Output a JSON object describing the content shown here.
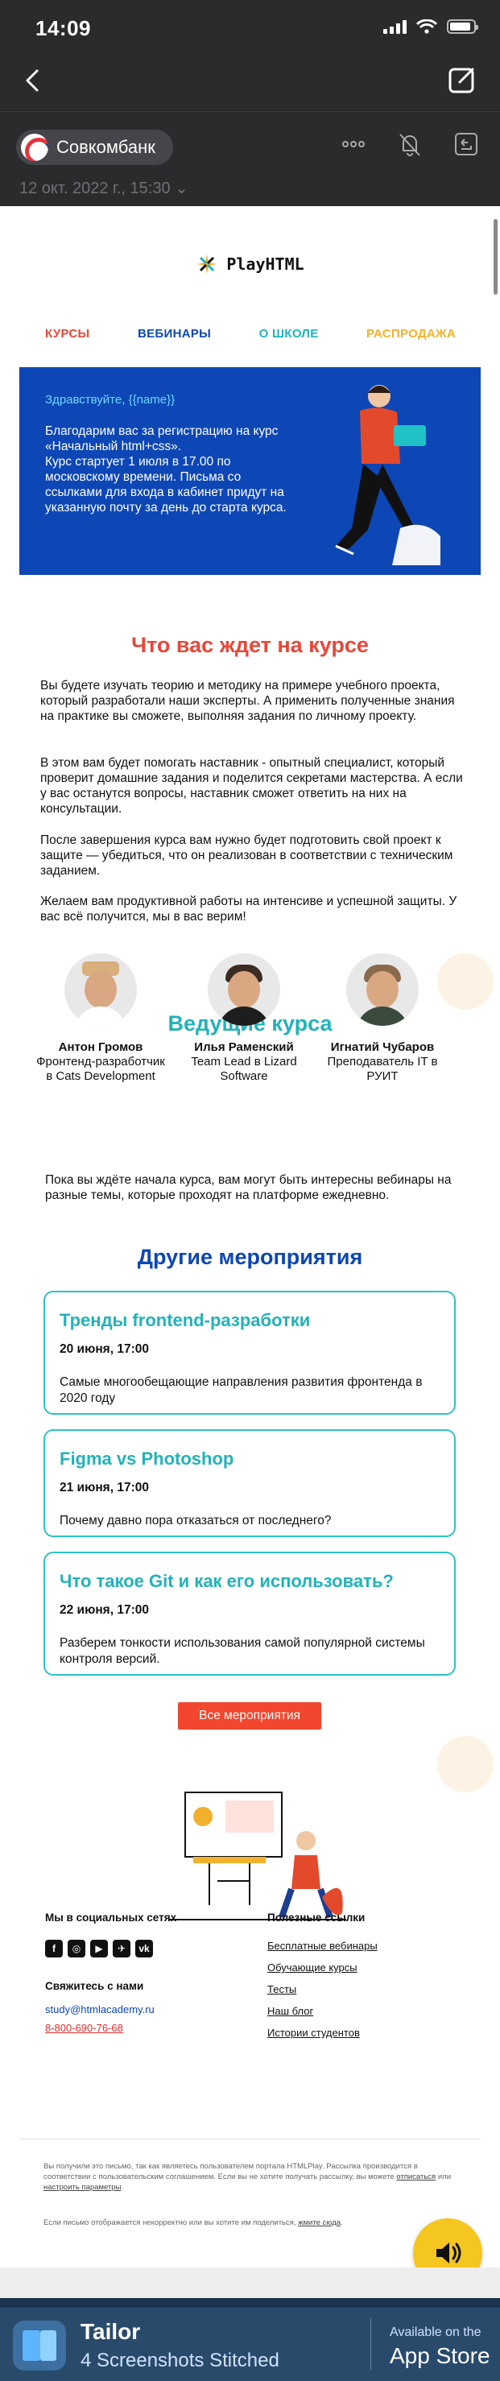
{
  "status": {
    "time": "14:09",
    "battery_level": 0.9
  },
  "mail": {
    "sender": "Совкомбанк",
    "date": "12 окт. 2022 г., 15:30"
  },
  "email": {
    "brand": "PlayHTML",
    "menu": [
      {
        "label": "КУРСЫ",
        "color": "#e8473a"
      },
      {
        "label": "ВЕБИНАРЫ",
        "color": "#0d47b5"
      },
      {
        "label": "О ШКОЛЕ",
        "color": "#21b3b8"
      },
      {
        "label": "РАСПРОДАЖА",
        "color": "#f2b12c"
      }
    ],
    "hero": {
      "greeting": "Здравствуйте, {{name}}",
      "text": "Благодарим вас за регистрацию на курс\n«Начальный html+css».\nКурс стартует 1 июля в 17.00 по московскому времени. Письма со ссылками для входа в кабинет придут на указанную почту за день до старта курса."
    },
    "section_course": {
      "title": "Что вас ждет на курсе",
      "p1": "Вы будете изучать теорию и методику на примере учебного проекта, который разработали наши эксперты. А применить полученные знания на практике вы сможете, выполняя задания по личному проекту.",
      "p2": "В этом вам будет помогать наставник - опытный специалист, который проверит домашние задания и поделится секретами мастерства. А если у вас останутся вопросы, наставник сможет ответить на них на консультации.",
      "p3": "После завершения курса вам нужно будет подготовить свой проект к защите — убедиться, что он реализован в соответствии с техническим заданием.",
      "p4": "Желаем вам продуктивной работы на интенсиве и успешной защиты. У вас всё получится, мы в вас верим!"
    },
    "mentors_title": "Ведущие курса",
    "mentors": [
      {
        "name": "Антон Громов",
        "role": "Фронтенд-разработчик в Cats Development"
      },
      {
        "name": "Илья Раменский",
        "role": "Team Lead в Lizard Software"
      },
      {
        "name": "Игнатий Чубаров",
        "role": "Преподаватель IT в РУИТ"
      }
    ],
    "events_intro": "Пока вы ждёте начала курса, вам могут быть интересны вебинары на разные темы, которые проходят на платформе ежедневно.",
    "events_title": "Другие мероприятия",
    "events": [
      {
        "title": "Тренды frontend-разработки",
        "date": "20 июня, 17:00",
        "desc": "Самые многообещающие направления развития фронтенда в 2020 году"
      },
      {
        "title": "Figma vs Photoshop",
        "date": "21 июня, 17:00",
        "desc": "Почему давно пора отказаться от последнего?"
      },
      {
        "title": "Что такое Git и как его использовать?",
        "date": "22 июня, 17:00",
        "desc": "Разберем тонкости использования самой популярной системы контроля версий."
      }
    ],
    "all_events_label": "Все мероприятия",
    "footer": {
      "social_title": "Мы в социальных сетях",
      "socials": [
        "f",
        "◎",
        "▶",
        "✈",
        "vk"
      ],
      "contact_title": "Свяжитесь с нами",
      "email": "study@htmlacademy.ru",
      "phone": "8-800-690-76-68",
      "links_title": "Полезные ссылки",
      "links": [
        "Бесплатные вебинары",
        "Обучающие курсы",
        "Тесты",
        "Наш блог",
        "Истории студентов"
      ],
      "legal1": "Вы получили это письмо, так как являетесь пользователем портала HTMLPlay. Рассылка производится в соответствии с пользовательским соглашением. Если вы не хотите получать рассылку, вы можете",
      "unsubscribe": "отписаться",
      "legal_or": " или ",
      "settings": "настроить параметры",
      "legal2": "Если письмо отображается некорректно или вы хотите им поделиться,",
      "view_here": "жмите сюда"
    }
  },
  "banner": {
    "app_name": "Tailor",
    "subtitle": "4 Screenshots Stitched",
    "store_small": "Available on the",
    "store_big": "App Store"
  },
  "colors": {
    "accent_blue": "#0d47b5",
    "accent_red": "#e8473a",
    "accent_teal": "#21b3b8",
    "button_red": "#f2462e"
  }
}
